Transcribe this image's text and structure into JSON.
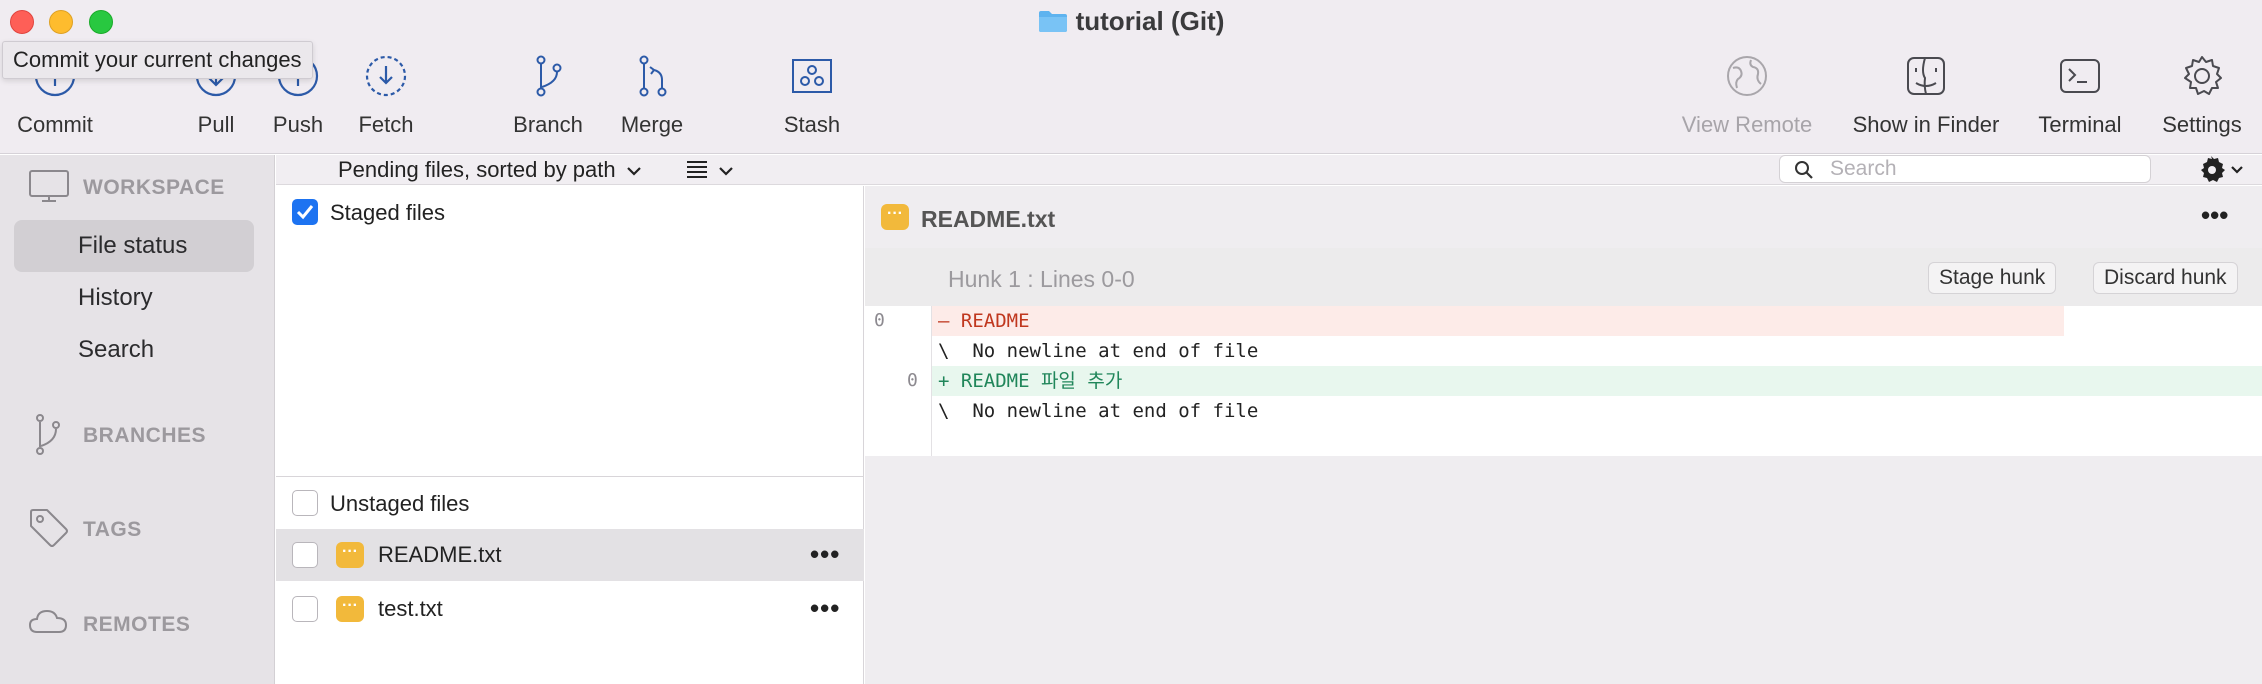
{
  "window": {
    "title": "tutorial (Git)",
    "tooltip": "Commit your current changes"
  },
  "toolbar": {
    "commit": "Commit",
    "pull": "Pull",
    "push": "Push",
    "fetch": "Fetch",
    "branch": "Branch",
    "merge": "Merge",
    "stash": "Stash",
    "view_remote": "View Remote",
    "show_in_finder": "Show in Finder",
    "terminal": "Terminal",
    "settings": "Settings"
  },
  "sidebar": {
    "workspace": "WORKSPACE",
    "items": [
      "File status",
      "History",
      "Search"
    ],
    "branches": "BRANCHES",
    "tags": "TAGS",
    "remotes": "REMOTES"
  },
  "filterbar": {
    "sort": "Pending files, sorted by path",
    "search_placeholder": "Search"
  },
  "files": {
    "staged_label": "Staged files",
    "unstaged_label": "Unstaged files",
    "unstaged": [
      {
        "name": "README.txt"
      },
      {
        "name": "test.txt"
      }
    ]
  },
  "diff": {
    "filename": "README.txt",
    "hunk_title": "Hunk 1 : Lines 0-0",
    "stage_hunk": "Stage hunk",
    "discard_hunk": "Discard hunk",
    "lines": [
      {
        "old": "0",
        "new": "",
        "text": "– README"
      },
      {
        "old": "",
        "new": "",
        "text": "\\  No newline at end of file"
      },
      {
        "old": "",
        "new": "0",
        "text": "+ README 파일 추가"
      },
      {
        "old": "",
        "new": "",
        "text": "\\  No newline at end of file"
      }
    ]
  },
  "colors": {
    "accent": "#1d73f1",
    "modified": "#f2b93b",
    "removed_bg": "#fdebe8",
    "added_bg": "#e8f7ee"
  }
}
